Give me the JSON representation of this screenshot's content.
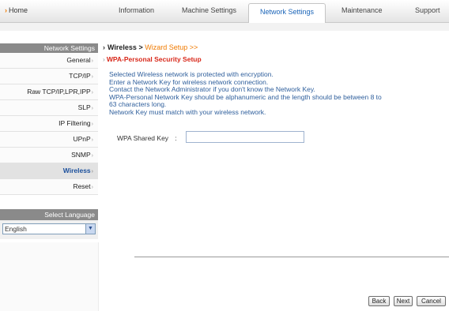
{
  "nav": {
    "home": "Home",
    "tabs": [
      {
        "label": "Information"
      },
      {
        "label": "Machine Settings"
      },
      {
        "label": "Network Settings"
      },
      {
        "label": "Maintenance"
      },
      {
        "label": "Support"
      }
    ],
    "active_tab": "Network Settings"
  },
  "sidebar": {
    "header": "Network Settings",
    "items": [
      {
        "label": "General"
      },
      {
        "label": "TCP/IP"
      },
      {
        "label": "Raw TCP/IP,LPR,IPP"
      },
      {
        "label": "SLP"
      },
      {
        "label": "IP Filtering"
      },
      {
        "label": "UPnP"
      },
      {
        "label": "SNMP"
      },
      {
        "label": "Wireless"
      },
      {
        "label": "Reset"
      }
    ],
    "active_item": "Wireless",
    "language_header": "Select Language",
    "language_value": "English"
  },
  "main": {
    "breadcrumb": {
      "section": "Wireless >",
      "wizard": "Wizard Setup >>"
    },
    "subtitle": "WPA-Personal Security Setup",
    "message_lines": [
      "Selected Wireless network is protected with encryption.",
      "Enter a Network Key for wireless network connection.",
      "Contact the Network Administrator if you don't know the Network Key.",
      "WPA-Personal Network Key should be alphanumeric and the length should be between 8 to",
      "63 characters long.",
      "Network Key must match with your wireless network."
    ],
    "field": {
      "label": "WPA Shared Key",
      "separator": ":",
      "value": ""
    }
  },
  "buttons": {
    "back": "Back",
    "next": "Next",
    "cancel": "Cancel"
  },
  "colors": {
    "accent_orange": "#f07a00",
    "title_red": "#d8281a",
    "text_blue": "#2f5f9c",
    "link_blue": "#1a4f9c"
  }
}
